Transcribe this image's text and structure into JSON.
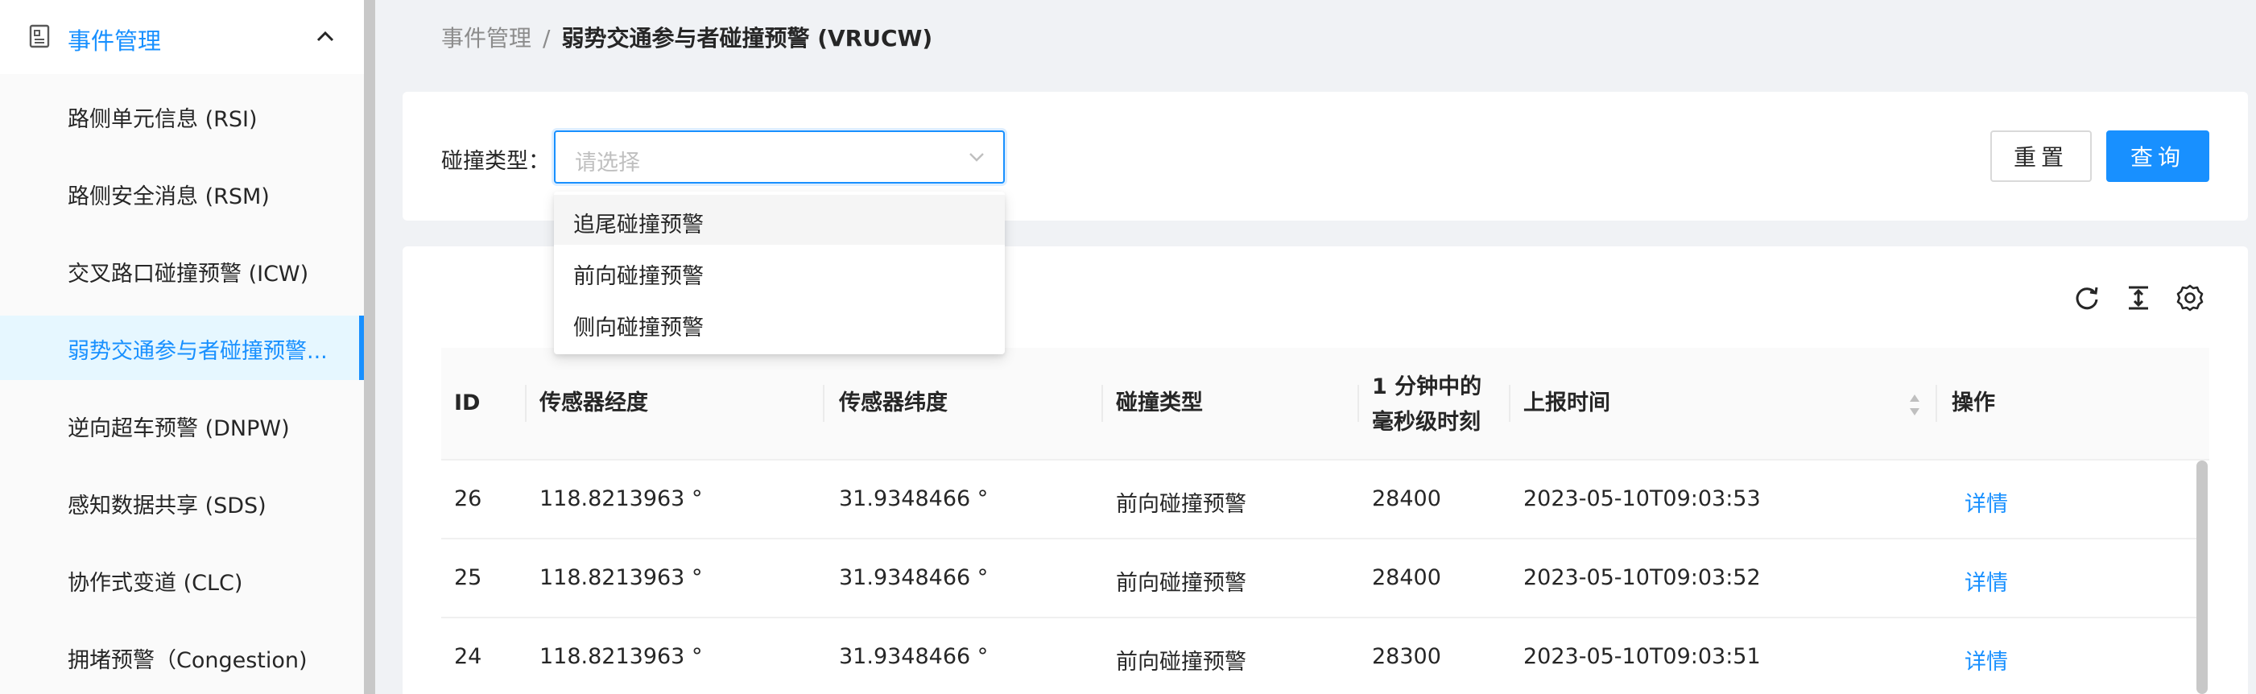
{
  "sidebar": {
    "group": {
      "label": "事件管理",
      "icon": "document-icon",
      "chevron": "chevron-up-icon"
    },
    "items": [
      {
        "label": "路侧单元信息 (RSI)",
        "active": false
      },
      {
        "label": "路侧安全消息 (RSM)",
        "active": false
      },
      {
        "label": "交叉路口碰撞预警 (ICW)",
        "active": false
      },
      {
        "label": "弱势交通参与者碰撞预警...",
        "active": true
      },
      {
        "label": "逆向超车预警 (DNPW)",
        "active": false
      },
      {
        "label": "感知数据共享 (SDS)",
        "active": false
      },
      {
        "label": "协作式变道 (CLC)",
        "active": false
      },
      {
        "label": "拥堵预警（Congestion)",
        "active": false
      }
    ]
  },
  "breadcrumb": {
    "parent": "事件管理",
    "separator": "/",
    "current": "弱势交通参与者碰撞预警 (VRUCW)"
  },
  "filter": {
    "label": "碰撞类型：",
    "placeholder": "请选择",
    "reset_label": "重置",
    "query_label": "查询",
    "dropdown_options": [
      "追尾碰撞预警",
      "前向碰撞预警",
      "侧向碰撞预警"
    ]
  },
  "toolbar": {
    "icons": [
      "refresh-icon",
      "column-height-icon",
      "settings-icon"
    ]
  },
  "table": {
    "columns": [
      "ID",
      "传感器经度",
      "传感器纬度",
      "碰撞类型",
      "1 分钟中的",
      "毫秒级时刻",
      "上报时间",
      "操作"
    ],
    "rows": [
      {
        "id": "26",
        "lng": "118.8213963 °",
        "lat": "31.9348466 °",
        "type": "前向碰撞预警",
        "ms": "28400",
        "time": "2023-05-10T09:03:53",
        "action": "详情"
      },
      {
        "id": "25",
        "lng": "118.8213963 °",
        "lat": "31.9348466 °",
        "type": "前向碰撞预警",
        "ms": "28400",
        "time": "2023-05-10T09:03:52",
        "action": "详情"
      },
      {
        "id": "24",
        "lng": "118.8213963 °",
        "lat": "31.9348466 °",
        "type": "前向碰撞预警",
        "ms": "28300",
        "time": "2023-05-10T09:03:51",
        "action": "详情"
      }
    ]
  },
  "colors": {
    "primary": "#1890ff",
    "active_bg": "#e6f7ff",
    "page_bg": "#f0f2f5"
  }
}
